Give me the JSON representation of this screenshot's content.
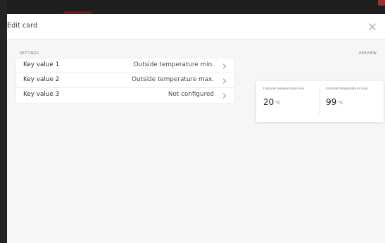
{
  "dialog": {
    "title": "Edit card"
  },
  "settings": {
    "section_label": "SETTINGS",
    "rows": [
      {
        "label": "Key value 1",
        "value": "Outside temperature min."
      },
      {
        "label": "Key value 2",
        "value": "Outside temperature max."
      },
      {
        "label": "Key value 3",
        "value": "Not configured"
      }
    ]
  },
  "preview": {
    "section_label": "PREVIEW",
    "items": [
      {
        "title": "Outside temperature min.",
        "value": "20",
        "unit": "°C"
      },
      {
        "title": "Outside temperature max.",
        "value": "99",
        "unit": "°C"
      }
    ]
  },
  "colors": {
    "backdrop": "#1e1e1e",
    "accent": "#b22d2d",
    "dialog_background": "#f6f6f6",
    "card_background": "#ffffff"
  },
  "icons": {
    "close": "close-icon",
    "row_chevron": "chevron-right-icon"
  }
}
